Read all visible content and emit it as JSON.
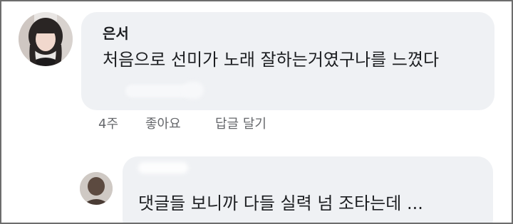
{
  "comment": {
    "author": "은서",
    "text": "처음으로 선미가 노래 잘하는거였구나를 느꼈다",
    "meta": {
      "time": "4주",
      "like_label": "좋아요",
      "reply_label": "답글 달기"
    }
  },
  "reply": {
    "text": "댓글들 보니까 다들 실력 넘 조타는데 ..."
  },
  "colors": {
    "bubble": "#eff1f4",
    "text": "#1c1e21",
    "meta": "#65676b",
    "frame": "#6d6d6d"
  }
}
